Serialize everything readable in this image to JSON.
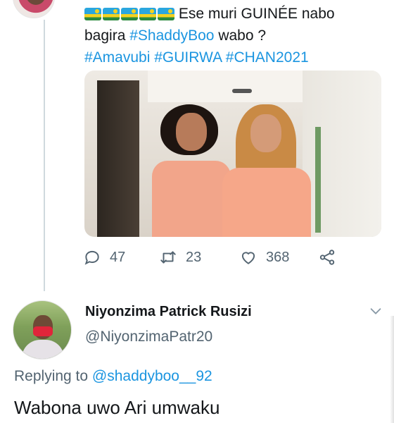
{
  "tweet": {
    "flag_count": 5,
    "text_line1": "Ese muri GUINÉE nabo",
    "text_line2_prefix": "bagira ",
    "hashtag1": "#ShaddyBoo",
    "text_line2_suffix": " wabo ?",
    "hashtags_line3": [
      "#Amavubi",
      "#GUIRWA",
      "#CHAN2021"
    ],
    "actions": {
      "reply_count": "47",
      "retweet_count": "23",
      "like_count": "368"
    },
    "icons": {
      "reply": "comment-icon",
      "retweet": "retweet-icon",
      "like": "heart-icon",
      "share": "share-icon"
    }
  },
  "reply": {
    "name": "Niyonzima Patrick Rusizi",
    "handle": "@NiyonzimaPatr20",
    "replying_to_label": "Replying to ",
    "replying_to_mention": "@shaddyboo__92",
    "body": "Wabona uwo Ari umwaku"
  },
  "colors": {
    "link": "#1b95e0",
    "text": "#14171a",
    "secondary": "#536471",
    "thread_line": "#cfd9de"
  }
}
